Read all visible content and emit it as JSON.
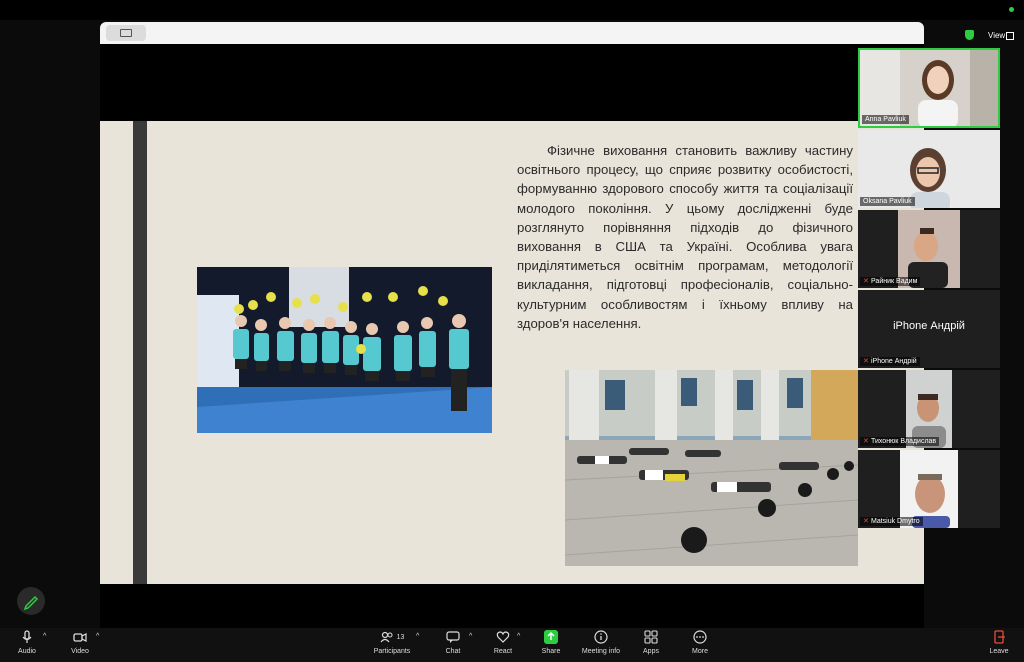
{
  "toolbar": {
    "audio": "Audio",
    "video": "Video",
    "participants": "Participants",
    "participants_count": "13",
    "chat": "Chat",
    "react": "React",
    "share": "Share",
    "meeting_info": "Meeting info",
    "apps": "Apps",
    "more": "More",
    "leave": "Leave"
  },
  "top_right": {
    "view": "View"
  },
  "slide": {
    "text": "Фізичне виховання становить важливу частину освітнього процесу, що сприяє розвитку особистості, формуванню здорового способу життя та соціалізації молодого покоління. У цьому дослідженні буде розглянуто порівняння підходів до фізичного виховання в США та Україні. Особлива увага приділятиметься освітнім програмам, методології викладання, підготовці професіоналів, соціально-культурним особливостям і їхньому впливу на здоров'я населення."
  },
  "participants": [
    {
      "name": "Anna Pavliuk",
      "muted": false
    },
    {
      "name": "Oksana Pavliuk",
      "muted": false
    },
    {
      "name": "Райник Вадим",
      "muted": true
    },
    {
      "name": "iPhone Андрій",
      "muted": true,
      "center": "iPhone Андрій"
    },
    {
      "name": "Тихонюк Владислав",
      "muted": true
    },
    {
      "name": "Matsiuk Dmytro",
      "muted": true
    }
  ],
  "colors": {
    "accent_green": "#2ecc40",
    "slide_bg": "#e9e4da",
    "muted_red": "#e74c3c"
  }
}
